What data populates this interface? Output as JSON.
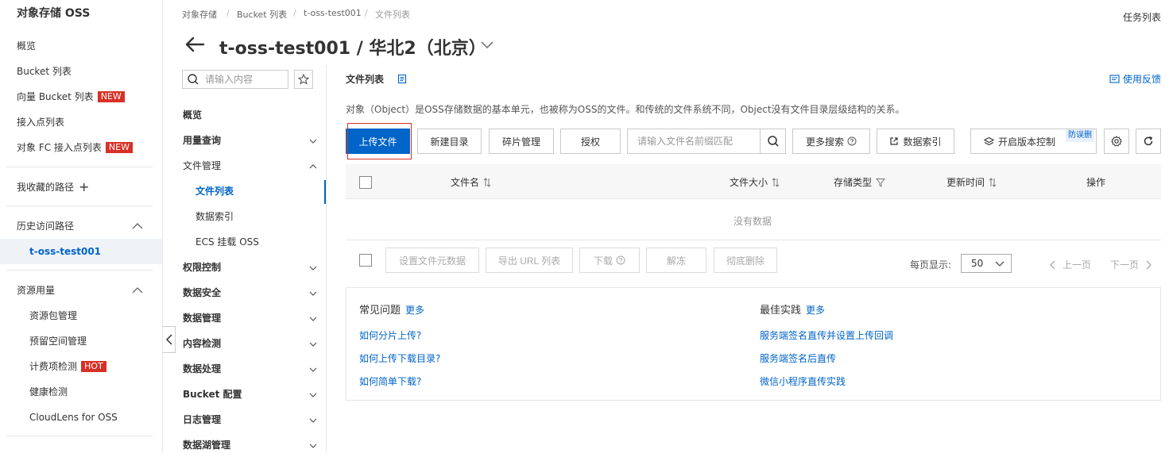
{
  "sidebar": {
    "title": "对象存储 OSS",
    "items": [
      {
        "label": "概览"
      },
      {
        "label": "Bucket 列表"
      },
      {
        "label": "向量 Bucket 列表",
        "badge": "NEW"
      },
      {
        "label": "接入点列表"
      },
      {
        "label": "对象 FC 接入点列表",
        "badge": "NEW"
      }
    ],
    "favorites_label": "我收藏的路径",
    "history_label": "历史访问路径",
    "history_items": [
      {
        "label": "t-oss-test001"
      }
    ],
    "resource_label": "资源用量",
    "resource_items": [
      {
        "label": "资源包管理"
      },
      {
        "label": "预留空间管理"
      },
      {
        "label": "计费项检测",
        "badge": "HOT"
      },
      {
        "label": "健康检测"
      },
      {
        "label": "CloudLens for OSS"
      }
    ]
  },
  "header": {
    "breadcrumb": [
      "对象存储",
      "Bucket 列表",
      "t-oss-test001",
      "文件列表"
    ],
    "task_list": "任务列表",
    "title": "t-oss-test001 / 华北2（北京）"
  },
  "nav": {
    "search_placeholder": "请输入内容",
    "items": [
      {
        "label": "概览"
      },
      {
        "label": "用量查询"
      },
      {
        "label": "文件管理"
      },
      {
        "label": "文件列表"
      },
      {
        "label": "数据索引"
      },
      {
        "label": "ECS 挂载 OSS"
      },
      {
        "label": "权限控制"
      },
      {
        "label": "数据安全"
      },
      {
        "label": "数据管理"
      },
      {
        "label": "内容检测"
      },
      {
        "label": "数据处理"
      },
      {
        "label": "Bucket 配置"
      },
      {
        "label": "日志管理"
      },
      {
        "label": "数据湖管理"
      }
    ]
  },
  "main": {
    "title": "文件列表",
    "feedback": "使用反馈",
    "description": "对象（Object）是OSS存储数据的基本单元，也被称为OSS的文件。和传统的文件系统不同，Object没有文件目录层级结构的关系。",
    "toolbar": {
      "upload": "上传文件",
      "new_dir": "新建目录",
      "fragments": "碎片管理",
      "authorize": "授权",
      "search_placeholder": "请输入文件名前缀匹配",
      "more_search": "更多搜索",
      "data_index": "数据索引",
      "versioning": "开启版本控制",
      "anti_delete_tag": "防误删"
    },
    "table": {
      "columns": [
        "文件名",
        "文件大小",
        "存储类型",
        "更新时间",
        "操作"
      ],
      "empty": "没有数据"
    },
    "batch": {
      "set_meta": "设置文件元数据",
      "export_url": "导出 URL 列表",
      "download": "下载",
      "unfreeze": "解冻",
      "delete": "彻底删除",
      "per_page_label": "每页显示:",
      "per_page_value": "50",
      "prev": "上一页",
      "next": "下一页"
    },
    "faq": {
      "title": "常见问题",
      "more": "更多",
      "links": [
        "如何分片上传?",
        "如何上传下载目录?",
        "如何简单下载?"
      ]
    },
    "best": {
      "title": "最佳实践",
      "more": "更多",
      "links": [
        "服务端签名直传并设置上传回调",
        "服务端签名后直传",
        "微信小程序直传实践"
      ]
    }
  },
  "colors": {
    "accent": "#0064c8",
    "badge": "#d93026",
    "highlight": "#d93026"
  }
}
